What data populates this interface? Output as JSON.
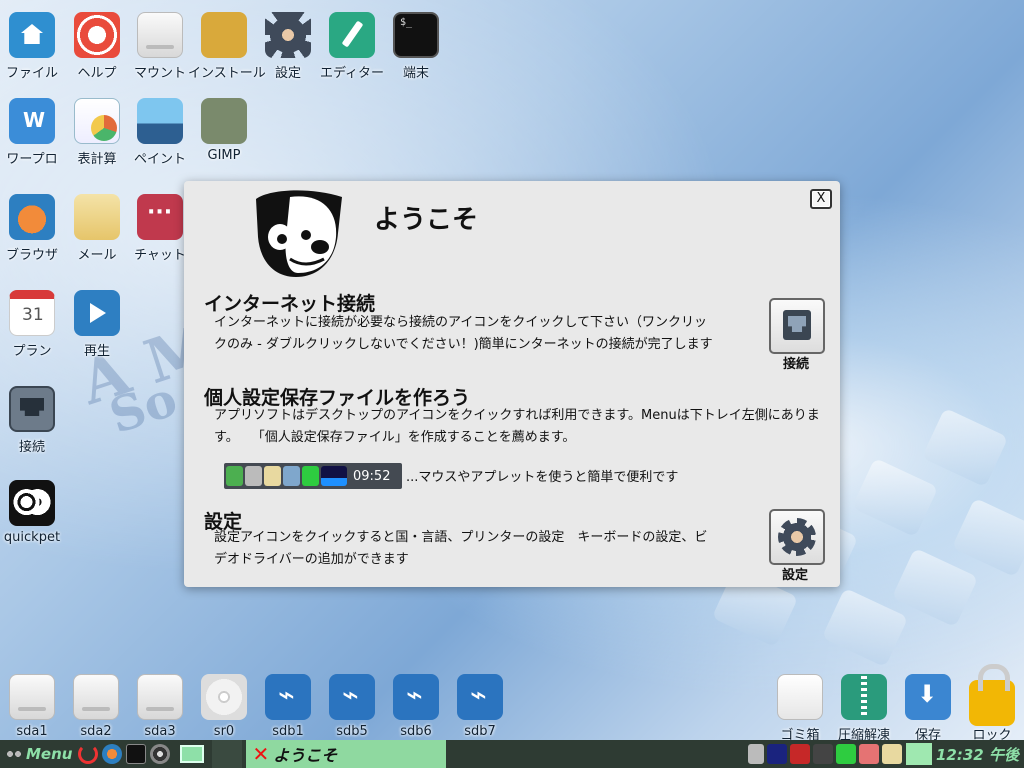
{
  "desktop": {
    "icons": [
      {
        "label": "ファイル"
      },
      {
        "label": "ヘルプ"
      },
      {
        "label": "マウント"
      },
      {
        "label": "インストール"
      },
      {
        "label": "設定"
      },
      {
        "label": "エディター"
      },
      {
        "label": "端末"
      },
      {
        "label": "ワープロ"
      },
      {
        "label": "表計算"
      },
      {
        "label": "ペイント"
      },
      {
        "label": "GIMP"
      },
      {
        "label": "ブラウザ"
      },
      {
        "label": "メール"
      },
      {
        "label": "チャット"
      },
      {
        "label": "プラン"
      },
      {
        "label": "再生"
      },
      {
        "label": "接続"
      },
      {
        "label": "quickpet"
      }
    ],
    "drives": [
      {
        "label": "sda1"
      },
      {
        "label": "sda2"
      },
      {
        "label": "sda3"
      },
      {
        "label": "sr0"
      },
      {
        "label": "sdb1"
      },
      {
        "label": "sdb5"
      },
      {
        "label": "sdb6"
      },
      {
        "label": "sdb7"
      }
    ],
    "right_icons": [
      {
        "label": "ゴミ箱"
      },
      {
        "label": "圧縮解凍"
      },
      {
        "label": "保存"
      },
      {
        "label": "ロック"
      }
    ]
  },
  "dialog": {
    "title": "ようこそ",
    "close_label": "X",
    "internet": {
      "heading": "インターネット接続",
      "line1": "インターネットに接続が必要なら接続のアイコンをクイックして下さい（ワンクリッ",
      "line2": "クのみ - ダブルクリックしないでください！)簡単にンターネットの接続が完了します",
      "button_label": "接続"
    },
    "save": {
      "heading": "個人設定保存ファイルを作ろう",
      "line1": "アプリソフトはデスクトップのアイコンをクイックすれば利用できます。Menuは下トレイ左側にありま",
      "line2": "す。　　「個人設定保存ファイル」を作成することを薦めます。",
      "tray_clock": "09:52",
      "tray_desc": "...マウスやアプレットを使うと簡単で便利です"
    },
    "settings": {
      "heading": "設定",
      "line1": "設定アイコンをクイックすると国・言語、プリンターの設定　キーボードの設定、ビ",
      "line2": "デオドライバーの追加ができます",
      "button_label": "設定"
    }
  },
  "taskbar": {
    "menu_label": "Menu",
    "task_title": "ようこそ",
    "clock": "12:32 午後"
  }
}
